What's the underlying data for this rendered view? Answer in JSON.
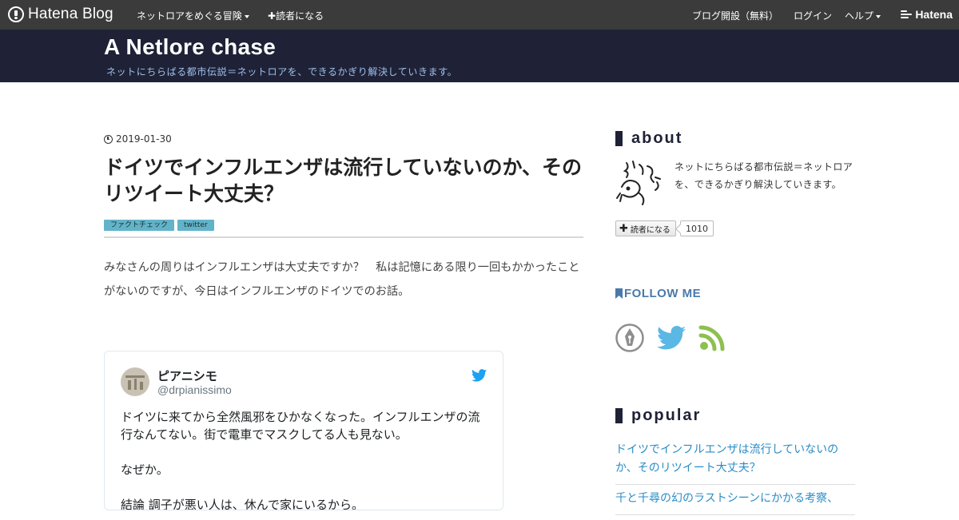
{
  "global_bar": {
    "logo_text": "Hatena Blog",
    "explore_menu": "ネットロアをめぐる冒険",
    "subscribe_link": "読者になる",
    "create_blog": "ブログ開設（無料）",
    "login": "ログイン",
    "help": "ヘルプ",
    "brand": "Hatena"
  },
  "blog": {
    "title": "A Netlore chase",
    "description": "ネットにちらばる都市伝説＝ネットロアを、できるかぎり解決していきます。"
  },
  "entry": {
    "date": "2019-01-30",
    "title": "ドイツでインフルエンザは流行していないのか、そのリツイート大丈夫？",
    "categories": [
      "ファクトチェック",
      "twitter"
    ],
    "body": "みなさんの周りはインフルエンザは大丈夫ですか？　私は記憶にある限り一回もかかったことがないのですが、今日はインフルエンザのドイツでのお話。"
  },
  "tweet": {
    "display_name": "ピアニシモ",
    "handle": "@drpianissimo",
    "text": "ドイツに来てから全然風邪をひかなくなった。インフルエンザの流行なんてない。街で電車でマスクしてる人も見ない。\n\nなぜか。\n\n結論 調子が悪い人は、休んで家にいるから。"
  },
  "sidebar": {
    "about_heading": "about",
    "about_text": "ネットにちらばる都市伝説＝ネットロアを、できるかぎり解決していきます。",
    "subscribe_button": "読者になる",
    "subscriber_count": "1010",
    "follow_heading": "FOLLOW ME",
    "popular_heading": "popular",
    "popular_items": [
      "ドイツでインフルエンザは流行していないのか、そのリツイート大丈夫？",
      "千と千尋の幻のラストシーンにかかる考察、"
    ]
  },
  "colors": {
    "global_bar": "#3b3b3b",
    "header_bg": "#1f2236",
    "description": "#9fc0ec",
    "category_tag": "#62b3c8",
    "link": "#2b8dc6",
    "follow": "#4a79a9",
    "twitter": "#1da1f2",
    "rss": "#8dc04f"
  }
}
